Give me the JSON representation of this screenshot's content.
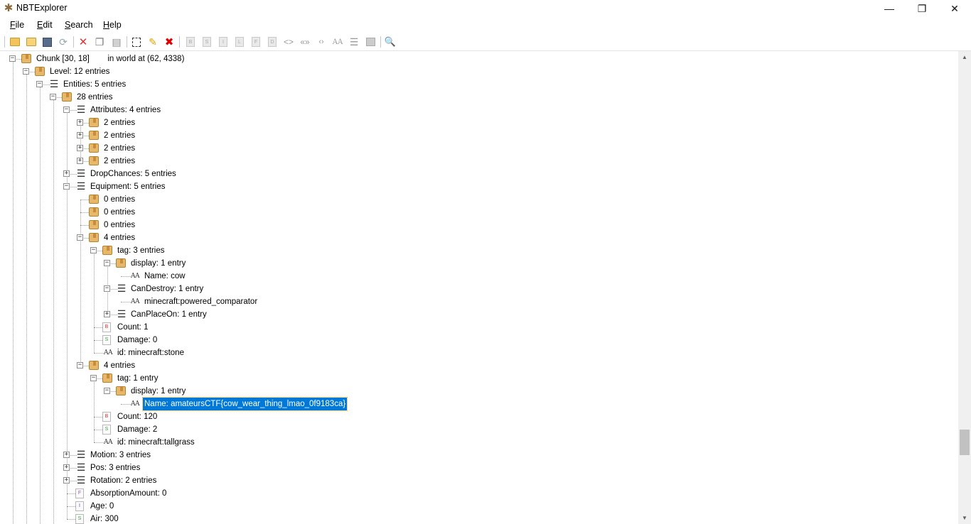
{
  "window": {
    "title": "NBTExplorer",
    "minimize_icon": "minimize-icon",
    "maximize_icon": "restore-icon",
    "close_icon": "close-icon"
  },
  "menu": [
    {
      "label": "File",
      "accel": "F"
    },
    {
      "label": "Edit",
      "accel": "E"
    },
    {
      "label": "Search",
      "accel": "S"
    },
    {
      "label": "Help",
      "accel": "H"
    }
  ],
  "toolbar": {
    "icons": [
      "open-file-icon",
      "open-folder-icon",
      "save-icon",
      "refresh-icon",
      "cut-icon",
      "copy-icon",
      "paste-icon",
      "rename-icon",
      "edit-icon",
      "delete-icon",
      "add-byte-icon",
      "add-short-icon",
      "add-int-icon",
      "add-long-icon",
      "add-float-icon",
      "add-double-icon",
      "add-byte-array-icon",
      "add-int-array-icon",
      "add-long-array-icon",
      "add-string-icon",
      "add-list-icon",
      "add-compound-icon",
      "find-icon"
    ],
    "tag_letters": [
      "B",
      "S",
      "I",
      "L",
      "F",
      "D"
    ]
  },
  "tree": {
    "nodes": [
      {
        "depth": 1,
        "type": "compound",
        "expanded": true,
        "label": "Chunk [30, 18]        in world at (62, 4338)"
      },
      {
        "depth": 2,
        "type": "compound",
        "expanded": true,
        "label": "Level: 12 entries"
      },
      {
        "depth": 3,
        "type": "list",
        "expanded": true,
        "label": "Entities: 5 entries"
      },
      {
        "depth": 4,
        "type": "compound",
        "expanded": true,
        "label": "28 entries"
      },
      {
        "depth": 5,
        "type": "list",
        "expanded": true,
        "label": "Attributes: 4 entries"
      },
      {
        "depth": 6,
        "type": "compound",
        "expanded": false,
        "label": "2 entries"
      },
      {
        "depth": 6,
        "type": "compound",
        "expanded": false,
        "label": "2 entries"
      },
      {
        "depth": 6,
        "type": "compound",
        "expanded": false,
        "label": "2 entries"
      },
      {
        "depth": 6,
        "type": "compound",
        "expanded": false,
        "label": "2 entries"
      },
      {
        "depth": 5,
        "type": "list",
        "expanded": false,
        "label": "DropChances: 5 entries"
      },
      {
        "depth": 5,
        "type": "list",
        "expanded": true,
        "label": "Equipment: 5 entries"
      },
      {
        "depth": 6,
        "type": "compound",
        "expanded": null,
        "label": "0 entries"
      },
      {
        "depth": 6,
        "type": "compound",
        "expanded": null,
        "label": "0 entries"
      },
      {
        "depth": 6,
        "type": "compound",
        "expanded": null,
        "label": "0 entries"
      },
      {
        "depth": 6,
        "type": "compound",
        "expanded": true,
        "label": "4 entries"
      },
      {
        "depth": 7,
        "type": "compound",
        "expanded": true,
        "label": "tag: 3 entries"
      },
      {
        "depth": 8,
        "type": "compound",
        "expanded": true,
        "label": "display: 1 entry"
      },
      {
        "depth": 9,
        "type": "string",
        "expanded": null,
        "label": "Name: cow"
      },
      {
        "depth": 8,
        "type": "list",
        "expanded": true,
        "label": "CanDestroy: 1 entry"
      },
      {
        "depth": 9,
        "type": "string",
        "expanded": null,
        "label": "minecraft:powered_comparator"
      },
      {
        "depth": 8,
        "type": "list",
        "expanded": false,
        "label": "CanPlaceOn: 1 entry"
      },
      {
        "depth": 7,
        "type": "byte",
        "expanded": null,
        "label": "Count: 1"
      },
      {
        "depth": 7,
        "type": "short",
        "expanded": null,
        "label": "Damage: 0"
      },
      {
        "depth": 7,
        "type": "string",
        "expanded": null,
        "label": "id: minecraft:stone"
      },
      {
        "depth": 6,
        "type": "compound",
        "expanded": true,
        "label": "4 entries"
      },
      {
        "depth": 7,
        "type": "compound",
        "expanded": true,
        "label": "tag: 1 entry"
      },
      {
        "depth": 8,
        "type": "compound",
        "expanded": true,
        "label": "display: 1 entry"
      },
      {
        "depth": 9,
        "type": "string",
        "expanded": null,
        "label": "Name: amateursCTF{cow_wear_thing_lmao_0f9183ca}",
        "selected": true
      },
      {
        "depth": 7,
        "type": "byte",
        "expanded": null,
        "label": "Count: 120"
      },
      {
        "depth": 7,
        "type": "short",
        "expanded": null,
        "label": "Damage: 2"
      },
      {
        "depth": 7,
        "type": "string",
        "expanded": null,
        "label": "id: minecraft:tallgrass"
      },
      {
        "depth": 5,
        "type": "list",
        "expanded": false,
        "label": "Motion: 3 entries"
      },
      {
        "depth": 5,
        "type": "list",
        "expanded": false,
        "label": "Pos: 3 entries"
      },
      {
        "depth": 5,
        "type": "list",
        "expanded": false,
        "label": "Rotation: 2 entries"
      },
      {
        "depth": 5,
        "type": "float",
        "expanded": null,
        "label": "AbsorptionAmount: 0"
      },
      {
        "depth": 5,
        "type": "int",
        "expanded": null,
        "label": "Age: 0"
      },
      {
        "depth": 5,
        "type": "short",
        "expanded": null,
        "label": "Air: 300"
      }
    ]
  },
  "colors": {
    "selection": "#0078d7",
    "compound": "#e8b86a"
  }
}
